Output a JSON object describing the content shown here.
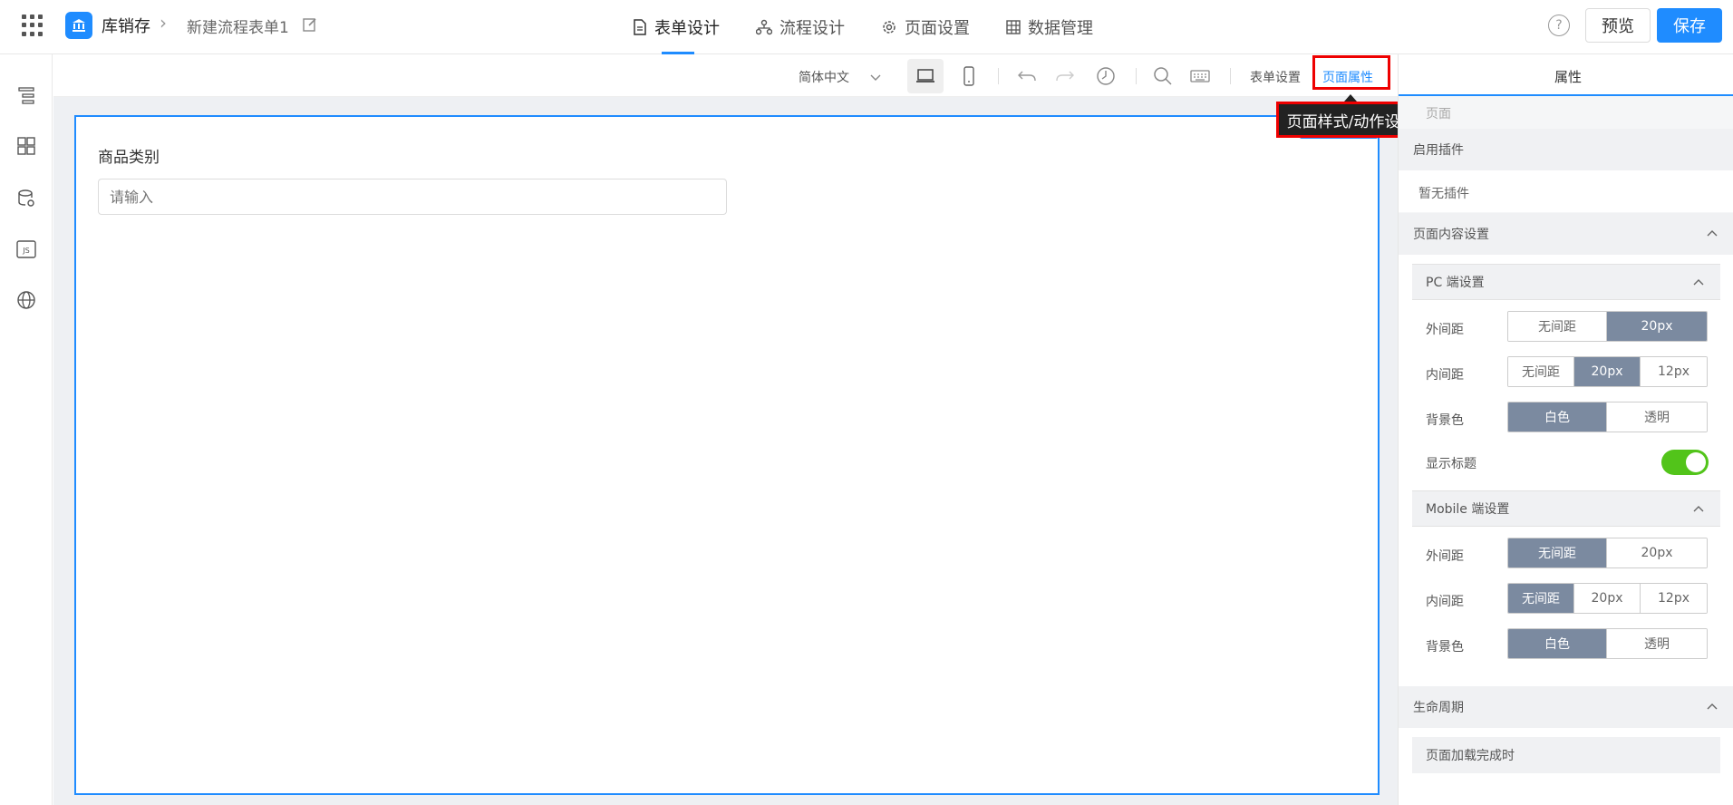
{
  "header": {
    "app_name": "库销存",
    "form_name": "新建流程表单1",
    "tabs": [
      {
        "label": "表单设计",
        "icon": "document-icon"
      },
      {
        "label": "流程设计",
        "icon": "flow-icon"
      },
      {
        "label": "页面设置",
        "icon": "gear-icon"
      },
      {
        "label": "数据管理",
        "icon": "table-icon"
      }
    ],
    "preview_label": "预览",
    "save_label": "保存",
    "help_glyph": "?"
  },
  "toolbar": {
    "language": "简体中文",
    "form_settings": "表单设置",
    "page_props": "页面属性",
    "tooltip": "页面样式/动作设置"
  },
  "canvas": {
    "field_label": "商品类别",
    "field_placeholder": "请输入"
  },
  "panel": {
    "tab": "属性",
    "page_label": "页面",
    "plugins_title": "启用插件",
    "plugins_empty": "暂无插件",
    "content_title": "页面内容设置",
    "pc_title": "PC 端设置",
    "mobile_title": "Mobile 端设置",
    "lifecycle_title": "生命周期",
    "lifecycle_item": "页面加载完成时",
    "labels": {
      "margin": "外间距",
      "padding": "内间距",
      "bg": "背景色",
      "show_title": "显示标题"
    },
    "opts": {
      "none": "无间距",
      "p20": "20px",
      "p12": "12px",
      "white": "白色",
      "transparent": "透明"
    }
  },
  "colors": {
    "accent": "#1f8cff",
    "selected": "#7b8aa0",
    "toggle_on": "#52c41a",
    "highlight": "#e00000"
  }
}
